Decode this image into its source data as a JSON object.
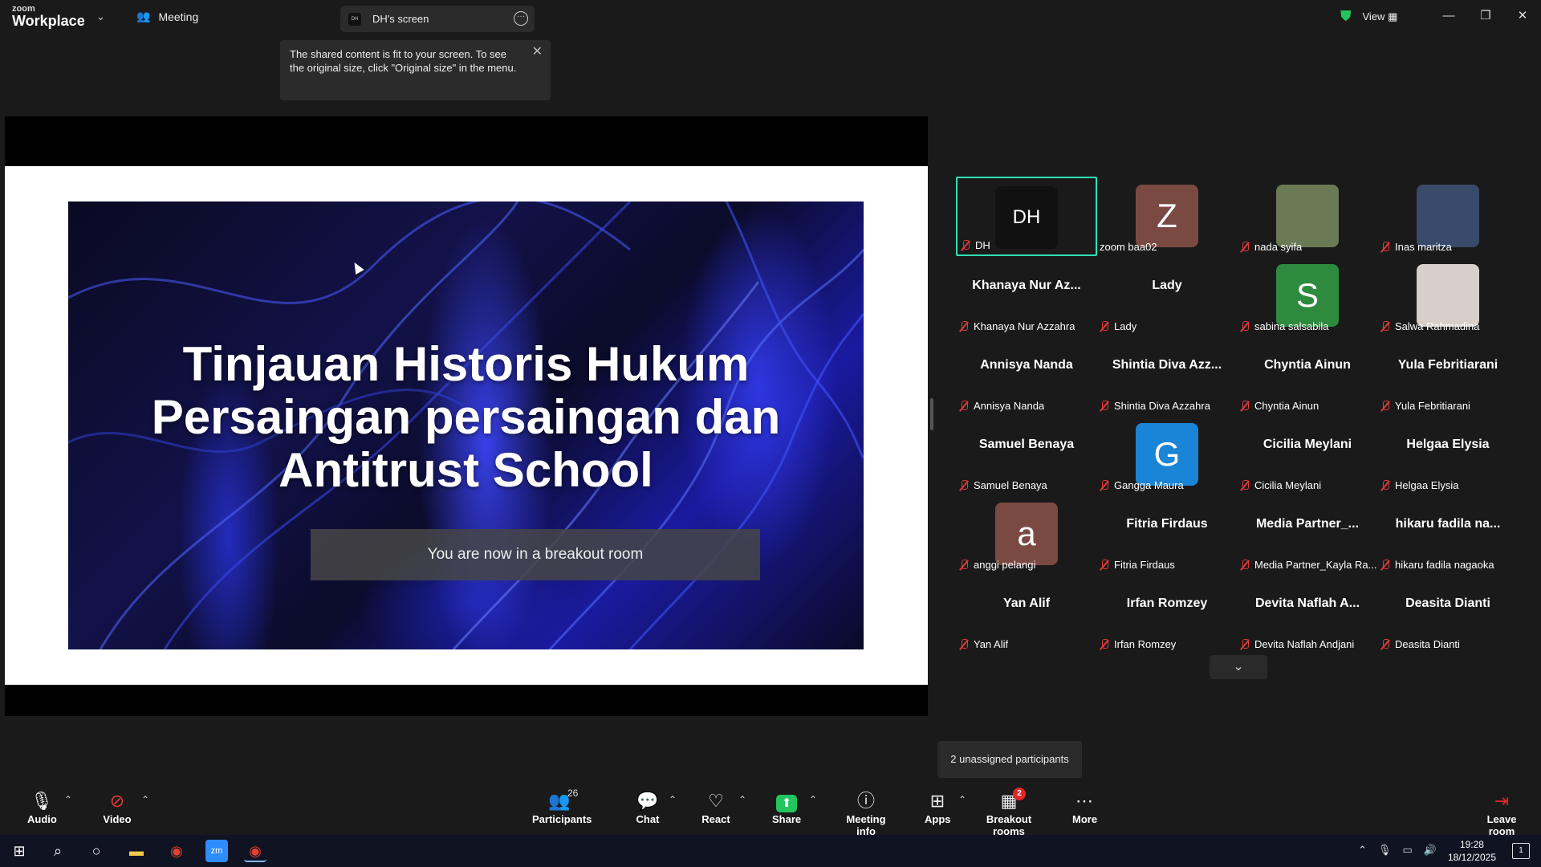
{
  "titlebar": {
    "logo_line1": "zoom",
    "logo_line2": "Workplace",
    "meeting_label": "Meeting",
    "screen_tab_label": "DH's screen",
    "view_label": "View"
  },
  "tooltip": {
    "text": "The shared content is fit to your screen. To see the original size, click \"Original size\" in the menu."
  },
  "slide": {
    "title_line1": "Tinjauan Historis Hukum",
    "title_line2": "Persaingan persaingan dan",
    "title_line3": "Antitrust School",
    "breakout_banner": "You are now in a breakout room"
  },
  "gallery": {
    "tiles": [
      {
        "name": "DH",
        "initials": "DH",
        "avatar_color": "#111111",
        "active": true
      },
      {
        "name": "zoom baa02",
        "initials": "Z",
        "avatar_color": "#7a4a42"
      },
      {
        "name": "nada syifa",
        "photo": true,
        "avatar_color": "#6a7a55"
      },
      {
        "name": "Inas maritza",
        "photo": true,
        "avatar_color": "#3a4a6a"
      },
      {
        "name": "Khanaya Nur Azzahra",
        "display": "Khanaya Nur Az..."
      },
      {
        "name": "Lady",
        "display": "Lady"
      },
      {
        "name": "sabina salsabila",
        "initials": "S",
        "avatar_color": "#2e8b3e"
      },
      {
        "name": "Salwa Rahmadina",
        "photo": true,
        "avatar_color": "#d8d0c8"
      },
      {
        "name": "Annisya Nanda",
        "display": "Annisya Nanda"
      },
      {
        "name": "Shintia Diva Azzahra",
        "display": "Shintia Diva Azz..."
      },
      {
        "name": "Chyntia Ainun",
        "display": "Chyntia Ainun"
      },
      {
        "name": "Yula Febritiarani",
        "display": "Yula Febritiarani"
      },
      {
        "name": "Samuel Benaya",
        "display": "Samuel Benaya"
      },
      {
        "name": "Gangga Maura",
        "initials": "G",
        "avatar_color": "#1a84d6"
      },
      {
        "name": "Cicilia Meylani",
        "display": "Cicilia Meylani"
      },
      {
        "name": "Helgaa Elysia",
        "display": "Helgaa Elysia"
      },
      {
        "name": "anggi pelangi",
        "initials": "a",
        "avatar_color": "#7a4a42"
      },
      {
        "name": "Fitria Firdaus",
        "display": "Fitria Firdaus"
      },
      {
        "name": "Media Partner_Kayla Ra...",
        "display": "Media  Partner_..."
      },
      {
        "name": "hikaru fadila nagaoka",
        "display": "hikaru  fadila  na..."
      },
      {
        "name": "Yan Alif",
        "display": "Yan Alif"
      },
      {
        "name": "Irfan Romzey",
        "display": "Irfan Romzey"
      },
      {
        "name": "Devita Naflah Andjani",
        "display": "Devita Naflah A..."
      },
      {
        "name": "Deasita Dianti",
        "display": "Deasita Dianti"
      }
    ]
  },
  "unassigned_text": "2 unassigned participants",
  "toolbar": {
    "audio": "Audio",
    "video": "Video",
    "participants": "Participants",
    "participants_count": "26",
    "chat": "Chat",
    "react": "React",
    "share": "Share",
    "meeting_info": "Meeting info",
    "apps": "Apps",
    "breakout_rooms": "Breakout rooms",
    "breakout_badge": "2",
    "more": "More",
    "leave": "Leave room"
  },
  "taskbar": {
    "time": "19:28",
    "date": "18/12/2025",
    "notif_count": "1"
  },
  "colors": {
    "active_border": "#2fe0b4",
    "mute_red": "#e03a3a",
    "share_green": "#22c55e",
    "leave_red": "#e02828"
  }
}
